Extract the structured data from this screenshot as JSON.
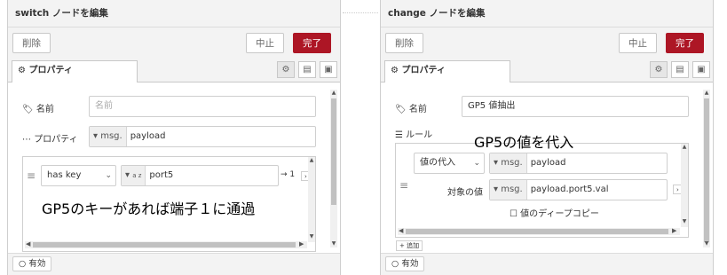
{
  "left_panel": {
    "title": "switch ノードを編集",
    "delete_label": "削除",
    "cancel_label": "中止",
    "done_label": "完了",
    "tab_label": "プロパティ",
    "name_label": "名前",
    "name_placeholder": "名前",
    "property_label": "プロパティ",
    "property_type": "msg.",
    "property_value": "payload",
    "rule_operator": "has key",
    "rule_type": "a z",
    "rule_value": "port5",
    "rule_output": "→ 1",
    "annotation": "GP5のキーがあれば端子１に通過",
    "enabled_label": "有効"
  },
  "right_panel": {
    "title": "change ノードを編集",
    "delete_label": "削除",
    "cancel_label": "中止",
    "done_label": "完了",
    "tab_label": "プロパティ",
    "name_label": "名前",
    "name_value": "GP5 値抽出",
    "rules_label": "ルール",
    "annotation": "GP5の値を代入",
    "action": "値の代入",
    "target_type": "msg.",
    "target_value": "payload",
    "value_label": "対象の値",
    "source_type": "msg.",
    "source_value": "payload.port5.val",
    "deep_copy_label": "値のディープコピー",
    "add_label": "追加",
    "enabled_label": "有効"
  },
  "icons": [
    "gear-icon",
    "tag-icon",
    "ellipsis-icon",
    "list-icon",
    "description-icon",
    "appearance-icon",
    "drag-handle-icon",
    "caret-down-icon",
    "chevron-down-icon"
  ],
  "colors": {
    "accent": "#ad1625"
  }
}
